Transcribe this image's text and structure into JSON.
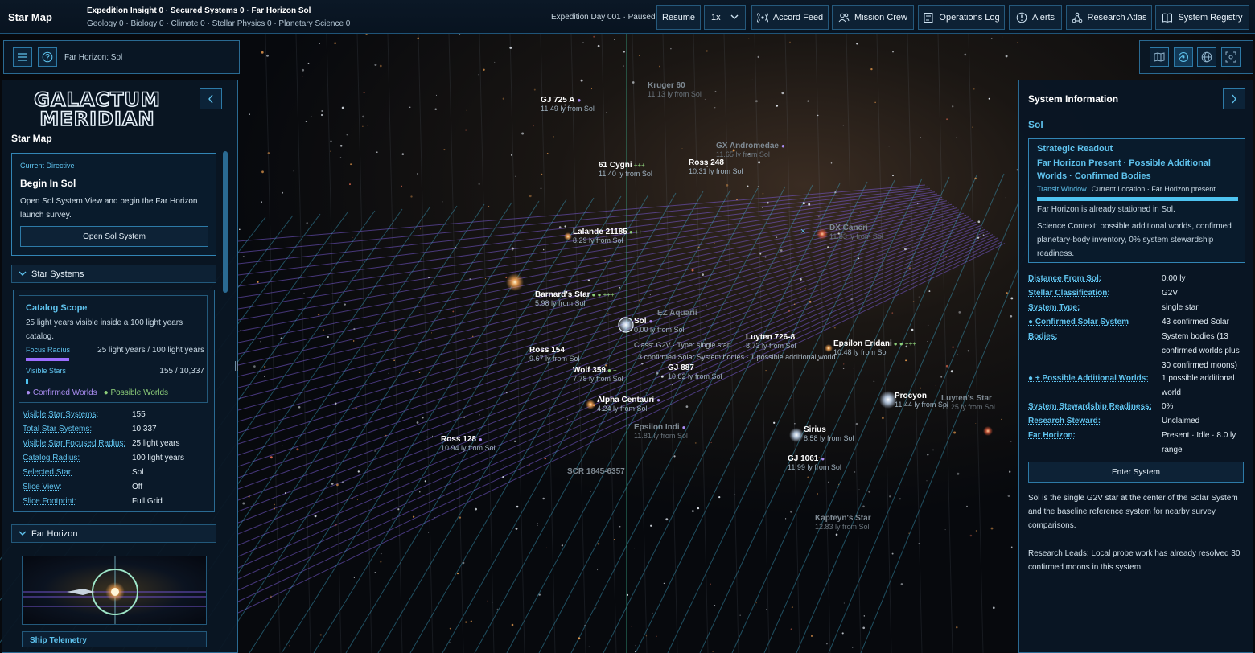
{
  "topbar": {
    "app_title": "Star Map",
    "insight_line": "Expedition Insight 0 · Secured Systems 0 · Far Horizon Sol",
    "sciences_line": "Geology 0 · Biology 0 · Climate 0 · Stellar Physics 0 · Planetary Science 0",
    "expedition_status": "Expedition Day 001 · Paused",
    "resume_label": "Resume",
    "speed_value": "1x",
    "buttons": [
      {
        "label": "Accord Feed",
        "icon": "broadcast-icon"
      },
      {
        "label": "Mission Crew",
        "icon": "users-icon"
      },
      {
        "label": "Operations Log",
        "icon": "log-icon"
      },
      {
        "label": "Alerts",
        "icon": "alert-icon"
      },
      {
        "label": "Research Atlas",
        "icon": "network-icon"
      },
      {
        "label": "System Registry",
        "icon": "book-icon"
      }
    ]
  },
  "left_subbar": {
    "breadcrumb": "Far Horizon: Sol"
  },
  "left_panel": {
    "logo_line1": "GALACTUM",
    "logo_line2": "MERIDIAN",
    "title": "Star Map",
    "directive": {
      "label": "Current Directive",
      "heading": "Begin In Sol",
      "body": "Open Sol System View and begin the Far Horizon launch survey.",
      "button": "Open Sol System"
    },
    "star_systems_section": "Star Systems",
    "catalog": {
      "title": "Catalog Scope",
      "description": "25 light years visible inside a 100 light years catalog.",
      "focus_label": "Focus Radius",
      "focus_value": "25 light years / 100 light years",
      "focus_fraction": 0.25,
      "visible_label": "Visible Stars",
      "visible_value": "155 / 10,337",
      "visible_fraction": 0.015,
      "legend_confirmed": "Confirmed Worlds",
      "legend_possible": "Possible Worlds"
    },
    "stats": [
      {
        "key": "Visible Star Systems:",
        "value": "155"
      },
      {
        "key": "Total Star Systems:",
        "value": "10,337"
      },
      {
        "key": "Visible Star Focused Radius:",
        "value": "25 light years"
      },
      {
        "key": "Catalog Radius:",
        "value": "100 light years"
      },
      {
        "key": "Selected Star:",
        "value": "Sol"
      },
      {
        "key": "Slice View:",
        "value": "Off"
      },
      {
        "key": "Slice Footprint:",
        "value": "Full Grid"
      }
    ],
    "far_horizon_section": "Far Horizon",
    "telemetry_label": "Ship Telemetry"
  },
  "right_panel": {
    "title": "System Information",
    "star_name": "Sol",
    "readout": {
      "label": "Strategic Readout",
      "heading": "Far Horizon Present · Possible Additional Worlds · Confirmed Bodies",
      "transit_label": "Transit Window",
      "transit_value": "Current Location · Far Horizon present",
      "transit_fraction": 1.0,
      "body1": "Far Horizon is already stationed in Sol.",
      "body2": "Science Context: possible additional worlds, confirmed planetary-body inventory, 0% system stewardship readiness."
    },
    "details": [
      {
        "key": "Distance From Sol:",
        "value": "0.00 ly"
      },
      {
        "key": "Stellar Classification:",
        "value": "G2V"
      },
      {
        "key": "System Type:",
        "value": "single star"
      },
      {
        "key": "● Confirmed Solar System Bodies:",
        "value": "43 confirmed Solar System bodies (13 confirmed worlds plus 30 confirmed moons)"
      },
      {
        "key": "● + Possible Additional Worlds:",
        "value": "1 possible additional world"
      },
      {
        "key": "System Stewardship Readiness:",
        "value": "0%"
      },
      {
        "key": "Research Steward:",
        "value": "Unclaimed"
      },
      {
        "key": "Far Horizon:",
        "value": "Present · Idle · 8.0 ly range"
      }
    ],
    "enter_button": "Enter System",
    "description": "Sol is the single G2V star at the center of the Solar System and the baseline reference system for nearby survey comparisons.",
    "research_leads": "Research Leads: Local probe work has already resolved 30 confirmed moons in this system."
  },
  "stars": [
    {
      "name": "GJ 725 A",
      "dist": "11.49 ly from Sol",
      "marks": "●",
      "dim": false
    },
    {
      "name": "Kruger 60",
      "dist": "11.13 ly from Sol",
      "marks": "",
      "dim": true
    },
    {
      "name": "61 Cygni",
      "dist": "11.40 ly from Sol",
      "marks": "+++",
      "dim": false
    },
    {
      "name": "GX Andromedae",
      "dist": "11.65 ly from Sol",
      "marks": "●",
      "dim": true
    },
    {
      "name": "Ross 248",
      "dist": "10.31 ly from Sol",
      "marks": "",
      "dim": false
    },
    {
      "name": "Lalande 21185",
      "dist": "8.29 ly from Sol",
      "marks": "● +++",
      "dim": false
    },
    {
      "name": "DX Cancri",
      "dist": "11.83 ly from Sol",
      "marks": "",
      "dim": true
    },
    {
      "name": "Barnard's Star",
      "dist": "5.98 ly from Sol",
      "marks": "● ● +++",
      "dim": false
    },
    {
      "name": "Sol",
      "dist": "0.00 ly from Sol",
      "marks": "●",
      "dim": false
    },
    {
      "name": "EZ Aquarii",
      "dist": "11.27 ly from Sol",
      "marks": "",
      "dim": true
    },
    {
      "name": "Ross 154",
      "dist": "9.67 ly from Sol",
      "marks": "",
      "dim": false
    },
    {
      "name": "Wolf 359",
      "dist": "7.78 ly from Sol",
      "marks": "● +",
      "dim": false
    },
    {
      "name": "GJ 887",
      "dist": "10.82 ly from Sol",
      "marks": "",
      "dim": false
    },
    {
      "name": "Luyten 726-8",
      "dist": "8.73 ly from Sol",
      "marks": "",
      "dim": false
    },
    {
      "name": "Epsilon Eridani",
      "dist": "10.48 ly from Sol",
      "marks": "● ● +++",
      "dim": false
    },
    {
      "name": "Alpha Centauri",
      "dist": "4.24 ly from Sol",
      "marks": "●",
      "dim": false
    },
    {
      "name": "Epsilon Indi",
      "dist": "11.81 ly from Sol",
      "marks": "●",
      "dim": true
    },
    {
      "name": "Procyon",
      "dist": "11.44 ly from Sol",
      "marks": "",
      "dim": false
    },
    {
      "name": "Luyten's Star",
      "dist": "11.25 ly from Sol",
      "marks": "",
      "dim": true
    },
    {
      "name": "Ross 128",
      "dist": "10.94 ly from Sol",
      "marks": "●",
      "dim": false
    },
    {
      "name": "Sirius",
      "dist": "8.58 ly from Sol",
      "marks": "",
      "dim": false
    },
    {
      "name": "GJ 1061",
      "dist": "11.99 ly from Sol",
      "marks": "●",
      "dim": false
    },
    {
      "name": "SCR 1845-6357",
      "dist": "",
      "marks": "",
      "dim": true
    },
    {
      "name": "Kapteyn's Star",
      "dist": "12.83 ly from Sol",
      "marks": "",
      "dim": true
    }
  ],
  "sol_info": {
    "line1": "Class: G2V · Type: single star",
    "line2": "13 confirmed Solar System bodies · 1 possible additional world"
  },
  "colors": {
    "accent": "#5fc3ee",
    "purple": "#9b6dff",
    "green": "#8ecf7a",
    "panel_border": "#2a6a92"
  }
}
